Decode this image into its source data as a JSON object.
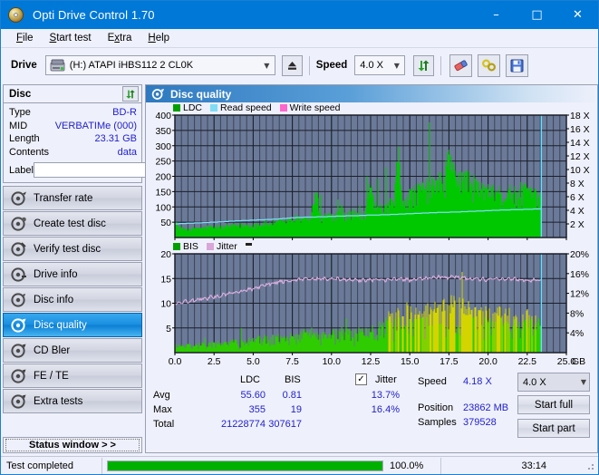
{
  "window": {
    "title": "Opti Drive Control 1.70",
    "icon": "disc-icon",
    "minimize": "–",
    "maximize": "□",
    "close": "✕"
  },
  "menubar": {
    "items": [
      {
        "label": "File",
        "accel": "F"
      },
      {
        "label": "Start test",
        "accel": "S"
      },
      {
        "label": "Extra",
        "accel": "x"
      },
      {
        "label": "Help",
        "accel": "H"
      }
    ]
  },
  "toolbar": {
    "drive_label": "Drive",
    "drive_value": "(H:)  ATAPI iHBS112  2 CL0K",
    "eject_icon": "eject-icon",
    "speed_label": "Speed",
    "speed_value": "4.0 X",
    "refresh_icon": "refresh-icon",
    "erase_icon": "eraser-icon",
    "settings_icon": "plugs-icon",
    "save_icon": "save-icon"
  },
  "disc": {
    "header": "Disc",
    "refresh_icon": "refresh-icon",
    "rows": [
      {
        "key": "Type",
        "value": "BD-R"
      },
      {
        "key": "MID",
        "value": "VERBATIMe (000)"
      },
      {
        "key": "Length",
        "value": "23.31 GB"
      },
      {
        "key": "Contents",
        "value": "data"
      }
    ],
    "label_key": "Label",
    "label_value": "",
    "label_placeholder": "",
    "label_button_icon": "disc-icon"
  },
  "nav": {
    "items": [
      {
        "label": "Transfer rate",
        "icon": "disc-speed-icon",
        "active": false
      },
      {
        "label": "Create test disc",
        "icon": "disc-write-icon",
        "active": false
      },
      {
        "label": "Verify test disc",
        "icon": "disc-verify-icon",
        "active": false
      },
      {
        "label": "Drive info",
        "icon": "drive-info-icon",
        "active": false
      },
      {
        "label": "Disc info",
        "icon": "disc-info-icon",
        "active": false
      },
      {
        "label": "Disc quality",
        "icon": "disc-quality-icon",
        "active": true
      },
      {
        "label": "CD Bler",
        "icon": "disc-bler-icon",
        "active": false
      },
      {
        "label": "FE / TE",
        "icon": "disc-fete-icon",
        "active": false
      },
      {
        "label": "Extra tests",
        "icon": "disc-extra-icon",
        "active": false
      }
    ],
    "status_window": "Status window > >"
  },
  "panel": {
    "title": "Disc quality",
    "icon": "disc-quality-icon"
  },
  "stats": {
    "col_ldc": "LDC",
    "col_bis": "BIS",
    "jitter_label": "Jitter",
    "jitter_checked": true,
    "jitter_check_glyph": "✓",
    "rows": [
      {
        "name": "Avg",
        "ldc": "55.60",
        "bis": "0.81",
        "jitter": "13.7%"
      },
      {
        "name": "Max",
        "ldc": "355",
        "bis": "19",
        "jitter": "16.4%"
      },
      {
        "name": "Total",
        "ldc": "21228774",
        "bis": "307617",
        "jitter": ""
      }
    ],
    "speed_key": "Speed",
    "speed_value": "4.18 X",
    "position_key": "Position",
    "position_value": "23862 MB",
    "samples_key": "Samples",
    "samples_value": "379528",
    "speed_select": "4.0 X",
    "start_full": "Start full",
    "start_part": "Start part"
  },
  "statusbar": {
    "message": "Test completed",
    "percent_text": "100.0%",
    "percent_value": 100,
    "elapsed": "33:14"
  },
  "colors": {
    "accent": "#0078d7",
    "plot_bg": "#6b7a99",
    "grid": "#2a2f3d",
    "ldc_green": "#00c800",
    "bis_green": "#2ecc00",
    "jitter_pink": "#e6b4e6",
    "read_speed": "#7fdcf5",
    "write_speed": "#ff66cc",
    "jitter_yellow": "#d4d400",
    "value_blue": "#2222cc",
    "progress_green": "#00b000"
  },
  "chart_data": [
    {
      "id": "ldc-chart",
      "type": "area",
      "title": "",
      "xlabel": "GB",
      "ylabel": "",
      "xlim": [
        0,
        25
      ],
      "ylim": [
        0,
        400
      ],
      "y2lim": [
        0,
        18
      ],
      "y2label": "X",
      "grid": true,
      "xticks": [
        "0.0",
        "2.5",
        "5.0",
        "7.5",
        "10.0",
        "12.5",
        "15.0",
        "17.5",
        "20.0",
        "22.5",
        "25.0"
      ],
      "yticks": [
        "400",
        "350",
        "300",
        "250",
        "200",
        "150",
        "100",
        "50"
      ],
      "y2ticks": [
        "18 X",
        "16 X",
        "14 X",
        "12 X",
        "10 X",
        "8 X",
        "6 X",
        "4 X",
        "2 X"
      ],
      "legend": [
        {
          "name": "LDC",
          "color": "#00c800"
        },
        {
          "name": "Read speed",
          "color": "#7fdcf5"
        },
        {
          "name": "Write speed",
          "color": "#ff66cc"
        }
      ],
      "legend_position": "top-left",
      "marker_x": 23.4,
      "data_end_x": 23.4,
      "series": [
        {
          "name": "LDC",
          "color": "#00c800",
          "kind": "area",
          "x": [
            0.0,
            0.25,
            0.5,
            0.75,
            1.0,
            1.25,
            1.5,
            1.75,
            2.0,
            2.25,
            2.5,
            2.75,
            3.0,
            3.25,
            3.5,
            3.75,
            4.0,
            4.25,
            4.5,
            4.75,
            5.0,
            5.25,
            5.5,
            5.75,
            6.0,
            6.25,
            6.5,
            6.75,
            7.0,
            7.25,
            7.5,
            7.75,
            8.0,
            8.25,
            8.5,
            8.75,
            9.0,
            9.25,
            9.5,
            9.75,
            10.0,
            10.25,
            10.5,
            10.75,
            11.0,
            11.25,
            11.5,
            11.75,
            12.0,
            12.25,
            12.5,
            12.75,
            13.0,
            13.25,
            13.5,
            13.75,
            14.0,
            14.25,
            14.5,
            14.75,
            15.0,
            15.25,
            15.5,
            15.75,
            16.0,
            16.25,
            16.5,
            16.75,
            17.0,
            17.25,
            17.5,
            17.75,
            18.0,
            18.25,
            18.5,
            18.75,
            19.0,
            19.25,
            19.5,
            19.75,
            20.0,
            20.25,
            20.5,
            20.75,
            21.0,
            21.25,
            21.5,
            21.75,
            22.0,
            22.25,
            22.5,
            22.75,
            23.0,
            23.4
          ],
          "values": [
            62,
            40,
            35,
            33,
            36,
            34,
            38,
            36,
            40,
            42,
            38,
            44,
            40,
            46,
            42,
            48,
            44,
            50,
            46,
            52,
            48,
            54,
            50,
            58,
            52,
            60,
            55,
            62,
            58,
            70,
            64,
            78,
            70,
            86,
            72,
            90,
            190,
            88,
            76,
            92,
            80,
            96,
            150,
            100,
            92,
            104,
            96,
            108,
            100,
            112,
            230,
            118,
            110,
            124,
            116,
            130,
            124,
            340,
            160,
            150,
            165,
            175,
            185,
            180,
            195,
            205,
            200,
            215,
            225,
            230,
            345,
            250,
            240,
            235,
            230,
            225,
            210,
            200,
            190,
            185,
            180,
            175,
            170,
            168,
            165,
            172,
            175,
            170,
            168,
            200,
            172,
            165,
            160,
            150
          ]
        },
        {
          "name": "Read speed",
          "color": "#7fdcf5",
          "kind": "line",
          "axis": "y2",
          "x": [
            0.0,
            0.5,
            1.0,
            1.5,
            2.0,
            2.5,
            3.0,
            3.5,
            4.0,
            4.5,
            5.0,
            5.5,
            6.0,
            6.5,
            7.0,
            7.5,
            8.0,
            8.5,
            9.0,
            9.5,
            10.0,
            10.5,
            11.0,
            11.5,
            12.0,
            12.5,
            13.0,
            13.5,
            14.0,
            14.5,
            15.0,
            15.5,
            16.0,
            16.5,
            17.0,
            17.5,
            18.0,
            18.5,
            19.0,
            19.5,
            20.0,
            20.5,
            21.0,
            21.5,
            22.0,
            22.5,
            23.0,
            23.4
          ],
          "values": [
            2.0,
            2.05,
            2.1,
            2.15,
            2.2,
            2.25,
            2.3,
            2.38,
            2.45,
            2.5,
            2.55,
            2.6,
            2.65,
            2.7,
            2.8,
            2.9,
            2.95,
            3.0,
            3.02,
            3.05,
            3.1,
            3.15,
            3.18,
            3.2,
            3.25,
            3.3,
            3.32,
            3.35,
            3.4,
            3.45,
            3.5,
            3.55,
            3.6,
            3.65,
            3.7,
            3.72,
            3.75,
            3.8,
            3.85,
            3.9,
            3.95,
            4.0,
            4.05,
            4.08,
            4.1,
            4.15,
            4.18,
            4.18
          ]
        }
      ]
    },
    {
      "id": "bis-jitter-chart",
      "type": "area",
      "title": "",
      "xlabel": "GB",
      "ylabel": "",
      "xlim": [
        0,
        25
      ],
      "ylim": [
        0,
        20
      ],
      "y2lim": [
        0,
        20
      ],
      "y2label": "%",
      "grid": true,
      "xticks": [
        "0.0",
        "2.5",
        "5.0",
        "7.5",
        "10.0",
        "12.5",
        "15.0",
        "17.5",
        "20.0",
        "22.5",
        "25.0"
      ],
      "yticks": [
        "20",
        "15",
        "10",
        "5"
      ],
      "y2ticks": [
        "20%",
        "16%",
        "12%",
        "8%",
        "4%"
      ],
      "legend": [
        {
          "name": "BIS",
          "color": "#2ecc00"
        },
        {
          "name": "Jitter",
          "color": "#e6b4e6"
        }
      ],
      "legend_position": "top-left",
      "marker_x": 23.4,
      "data_end_x": 23.4,
      "series": [
        {
          "name": "BIS",
          "color": "#2ecc00",
          "kind": "area",
          "x": [
            0.0,
            0.25,
            0.5,
            0.75,
            1.0,
            1.25,
            1.5,
            1.75,
            2.0,
            2.25,
            2.5,
            2.75,
            3.0,
            3.25,
            3.5,
            3.75,
            4.0,
            4.25,
            4.5,
            4.75,
            5.0,
            5.25,
            5.5,
            5.75,
            6.0,
            6.25,
            6.5,
            6.75,
            7.0,
            7.25,
            7.5,
            7.75,
            8.0,
            8.25,
            8.5,
            8.75,
            9.0,
            9.25,
            9.5,
            9.75,
            10.0,
            10.25,
            10.5,
            10.75,
            11.0,
            11.25,
            11.5,
            11.75,
            12.0,
            12.25,
            12.5,
            12.75,
            13.0,
            13.25,
            13.5,
            13.75,
            14.0,
            14.25,
            14.5,
            14.75,
            15.0,
            15.25,
            15.5,
            15.75,
            16.0,
            16.25,
            16.5,
            16.75,
            17.0,
            17.25,
            17.5,
            17.75,
            18.0,
            18.25,
            18.5,
            18.75,
            19.0,
            19.25,
            19.5,
            19.75,
            20.0,
            20.25,
            20.5,
            20.75,
            21.0,
            21.25,
            21.5,
            21.75,
            22.0,
            22.25,
            22.5,
            22.75,
            23.0,
            23.4
          ],
          "values": [
            2.0,
            1.8,
            1.9,
            2.0,
            1.8,
            2.1,
            1.9,
            2.2,
            2.0,
            2.3,
            2.1,
            2.4,
            2.2,
            2.5,
            2.4,
            3.0,
            2.6,
            3.2,
            2.8,
            3.4,
            3.0,
            3.6,
            3.2,
            3.8,
            3.4,
            4.0,
            3.6,
            4.6,
            3.8,
            5.0,
            4.2,
            5.2,
            4.4,
            5.0,
            4.6,
            5.2,
            4.8,
            5.0,
            4.6,
            5.4,
            4.8,
            5.2,
            5.0,
            5.4,
            5.2,
            5.6,
            5.0,
            5.4,
            5.2,
            5.6,
            5.4,
            6.0,
            6.5,
            7.5,
            8.0,
            9.0,
            8.5,
            9.5,
            9.0,
            10.5,
            9.5,
            10.0,
            9.0,
            10.5,
            9.5,
            11.0,
            10.0,
            11.5,
            10.5,
            12.0,
            11.5,
            12.5,
            12.0,
            11.5,
            11.0,
            10.5,
            10.0,
            10.5,
            9.5,
            10.0,
            9.5,
            10.0,
            9.0,
            9.5,
            9.0,
            9.5,
            9.0,
            8.5,
            9.0,
            8.5,
            9.0,
            8.5,
            8.0,
            7.5
          ]
        },
        {
          "name": "Jitter",
          "color": "#e6b4e6",
          "kind": "line",
          "x": [
            0.0,
            0.5,
            1.0,
            1.5,
            2.0,
            2.5,
            3.0,
            3.5,
            4.0,
            4.5,
            5.0,
            5.5,
            6.0,
            6.5,
            7.0,
            7.5,
            8.0,
            8.5,
            9.0,
            9.5,
            10.0,
            10.5,
            11.0,
            11.5,
            12.0,
            12.5,
            13.0,
            13.5,
            14.0,
            14.5,
            15.0,
            15.5,
            16.0,
            16.5,
            17.0,
            17.5,
            18.0,
            18.5,
            19.0,
            19.5,
            20.0,
            20.5,
            21.0,
            21.5,
            22.0,
            22.5,
            23.0,
            23.4
          ],
          "values": [
            10.0,
            10.2,
            10.5,
            10.8,
            11.0,
            11.3,
            11.6,
            11.9,
            12.2,
            12.6,
            13.0,
            13.4,
            13.8,
            14.2,
            14.5,
            14.7,
            14.8,
            15.0,
            14.9,
            15.0,
            14.8,
            14.9,
            14.8,
            14.7,
            14.6,
            14.8,
            14.7,
            14.6,
            14.8,
            14.9,
            14.7,
            14.9,
            15.0,
            15.2,
            15.3,
            15.2,
            15.3,
            15.1,
            15.0,
            14.9,
            14.8,
            14.9,
            14.8,
            14.9,
            14.8,
            14.7,
            14.6,
            14.5
          ]
        }
      ]
    }
  ]
}
